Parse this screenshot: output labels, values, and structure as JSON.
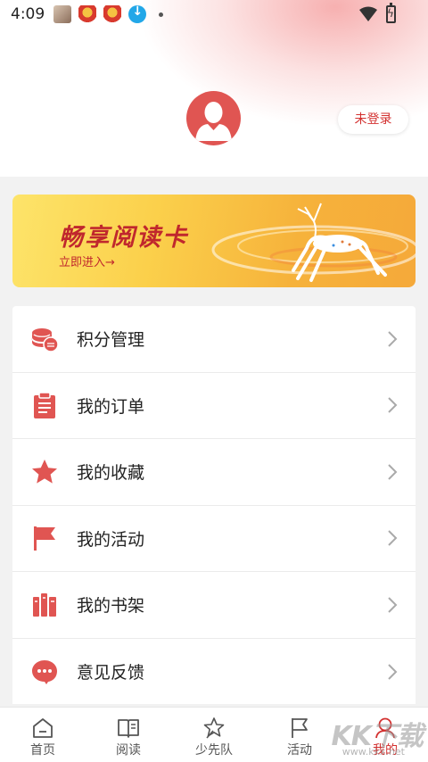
{
  "status_bar": {
    "time": "4:09",
    "notifications": [
      "photo-notification-icon",
      "red-badge-icon",
      "red-badge-icon",
      "download-icon"
    ]
  },
  "header": {
    "avatar_icon": "user-avatar-icon",
    "login_label": "未登录"
  },
  "banner": {
    "title": "畅享阅读卡",
    "subtitle": "立即进入→"
  },
  "menu": {
    "items": [
      {
        "label": "积分管理",
        "icon": "coins-icon"
      },
      {
        "label": "我的订单",
        "icon": "clipboard-icon"
      },
      {
        "label": "我的收藏",
        "icon": "star-icon"
      },
      {
        "label": "我的活动",
        "icon": "flag-icon"
      },
      {
        "label": "我的书架",
        "icon": "bookshelf-icon"
      },
      {
        "label": "意见反馈",
        "icon": "chat-bubble-icon"
      }
    ]
  },
  "tabbar": {
    "tabs": [
      {
        "label": "首页",
        "icon": "home-icon"
      },
      {
        "label": "阅读",
        "icon": "book-icon"
      },
      {
        "label": "少先队",
        "icon": "star-badge-icon"
      },
      {
        "label": "活动",
        "icon": "flag-outline-icon"
      },
      {
        "label": "我的",
        "icon": "user-icon"
      }
    ],
    "active_index": 4
  },
  "watermark": {
    "text": "KK下载",
    "url": "www.kkx.net"
  },
  "colors": {
    "accent": "#d3302f",
    "icon_red": "#e05552",
    "background": "#f2f2f2"
  }
}
